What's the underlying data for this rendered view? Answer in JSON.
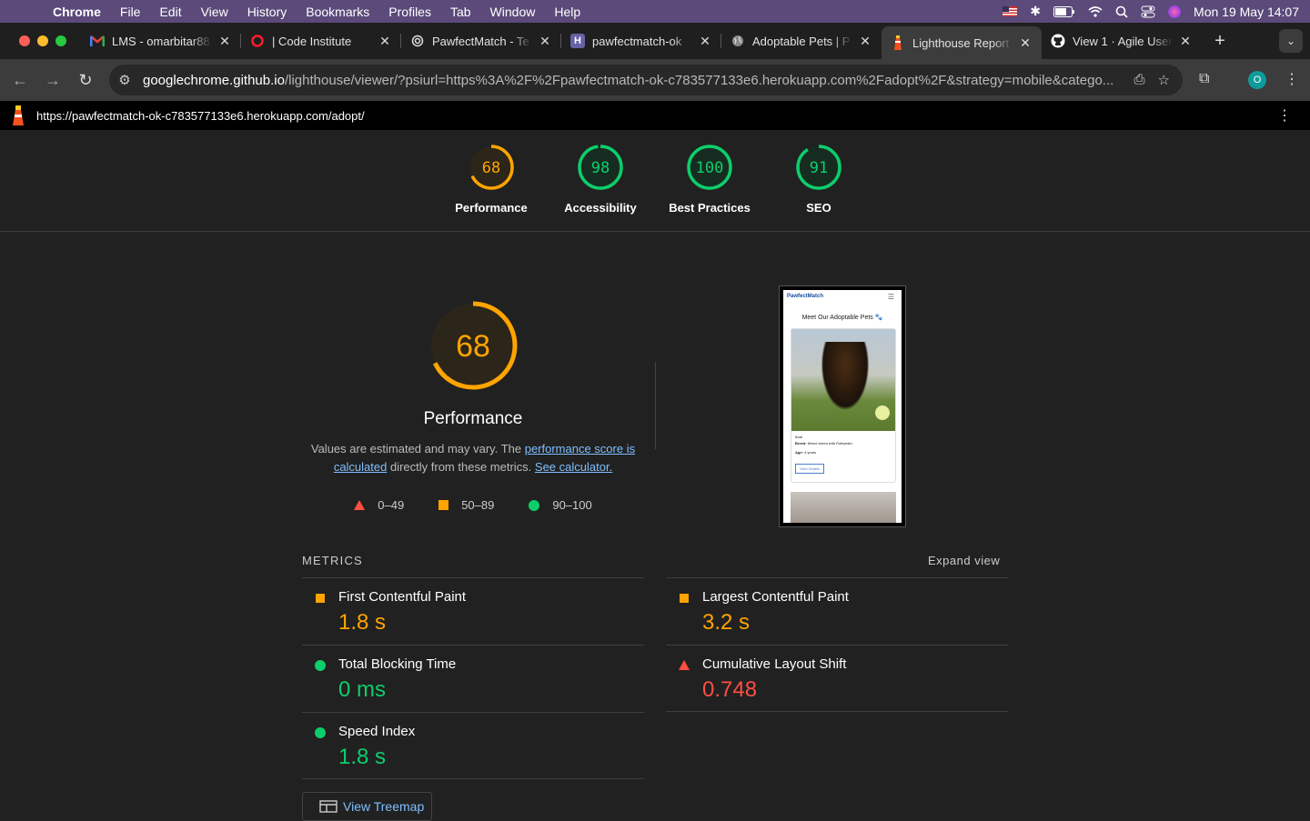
{
  "menubar": {
    "app": "Chrome",
    "items": [
      "File",
      "Edit",
      "View",
      "History",
      "Bookmarks",
      "Profiles",
      "Tab",
      "Window",
      "Help"
    ],
    "clock": "Mon 19 May  14:07"
  },
  "tabs": [
    {
      "title": "LMS - omarbitar88",
      "icon": "gmail-icon"
    },
    {
      "title": "| Code Institute",
      "icon": "opera-icon"
    },
    {
      "title": "PawfectMatch - Te",
      "icon": "openai-icon"
    },
    {
      "title": "pawfectmatch-ok",
      "icon": "heroku-icon"
    },
    {
      "title": "Adoptable Pets | P",
      "icon": "globe-icon"
    },
    {
      "title": "Lighthouse Report",
      "icon": "lighthouse-icon",
      "active": true
    },
    {
      "title": "View 1 · Agile User",
      "icon": "github-icon"
    }
  ],
  "address": {
    "domain": "googlechrome.github.io",
    "path": "/lighthouse/viewer/?psiurl=https%3A%2F%2Fpawfectmatch-ok-c783577133e6.herokuapp.com%2Fadopt%2F&strategy=mobile&catego..."
  },
  "profile_initial": "O",
  "report_url": "https://pawfectmatch-ok-c783577133e6.herokuapp.com/adopt/",
  "scores": [
    {
      "label": "Performance",
      "score": 68,
      "color": "#ffa400"
    },
    {
      "label": "Accessibility",
      "score": 98,
      "color": "#0cce6b"
    },
    {
      "label": "Best Practices",
      "score": 100,
      "color": "#0cce6b"
    },
    {
      "label": "SEO",
      "score": 91,
      "color": "#0cce6b"
    }
  ],
  "performance": {
    "score": 68,
    "title": "Performance",
    "desc_before": "Values are estimated and may vary. The ",
    "link1": "performance score is calculated",
    "desc_mid": " directly from these metrics. ",
    "link2": "See calculator.",
    "legend": [
      "0–49",
      "50–89",
      "90–100"
    ]
  },
  "preview": {
    "brand": "PawfectMatch",
    "heading": "Meet Our Adoptable Pets 🐾",
    "pet_name": "Bodi",
    "breed_label": "Breed:",
    "breed": "Mixed breed with Rottweiler",
    "age_label": "Age:",
    "age": "4 years",
    "button": "View Details"
  },
  "metrics": {
    "title": "METRICS",
    "expand": "Expand view",
    "left": [
      {
        "name": "First Contentful Paint",
        "value": "1.8 s",
        "status": "average"
      },
      {
        "name": "Total Blocking Time",
        "value": "0 ms",
        "status": "pass"
      },
      {
        "name": "Speed Index",
        "value": "1.8 s",
        "status": "pass"
      }
    ],
    "right": [
      {
        "name": "Largest Contentful Paint",
        "value": "3.2 s",
        "status": "average"
      },
      {
        "name": "Cumulative Layout Shift",
        "value": "0.748",
        "status": "fail"
      }
    ]
  },
  "treemap_label": "View Treemap",
  "colors": {
    "pass": "#0cce6b",
    "average": "#ffa400",
    "fail": "#ff4e42"
  }
}
